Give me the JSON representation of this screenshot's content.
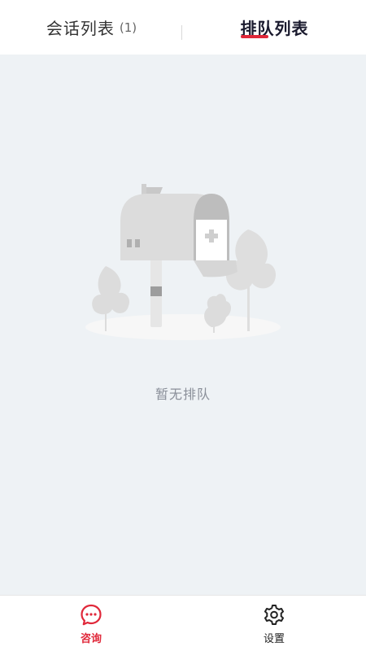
{
  "header": {
    "tabs": [
      {
        "label": "会话列表",
        "count": "(1)",
        "active": false
      },
      {
        "label": "排队列表",
        "active": true
      }
    ]
  },
  "empty_state": {
    "icon": "mailbox-illustration",
    "message": "暂无排队"
  },
  "bottom_nav": {
    "items": [
      {
        "label": "咨询",
        "icon": "chat-bubble-icon",
        "active": true
      },
      {
        "label": "设置",
        "icon": "gear-icon",
        "active": false
      }
    ]
  },
  "colors": {
    "accent": "#e0283a",
    "background": "#eef2f5",
    "muted_text": "#8a8f99"
  }
}
